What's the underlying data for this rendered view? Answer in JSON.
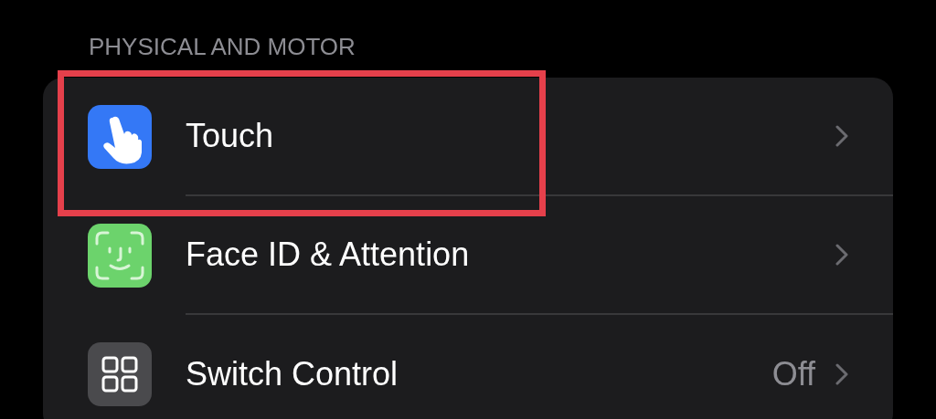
{
  "section_header": "PHYSICAL AND MOTOR",
  "rows": [
    {
      "kind": "hand",
      "label": "Touch",
      "highlighted": true
    },
    {
      "kind": "face",
      "label": "Face ID & Attention",
      "highlighted": false
    },
    {
      "kind": "grid",
      "label": "Switch Control",
      "value": "Off",
      "highlighted": false
    }
  ]
}
